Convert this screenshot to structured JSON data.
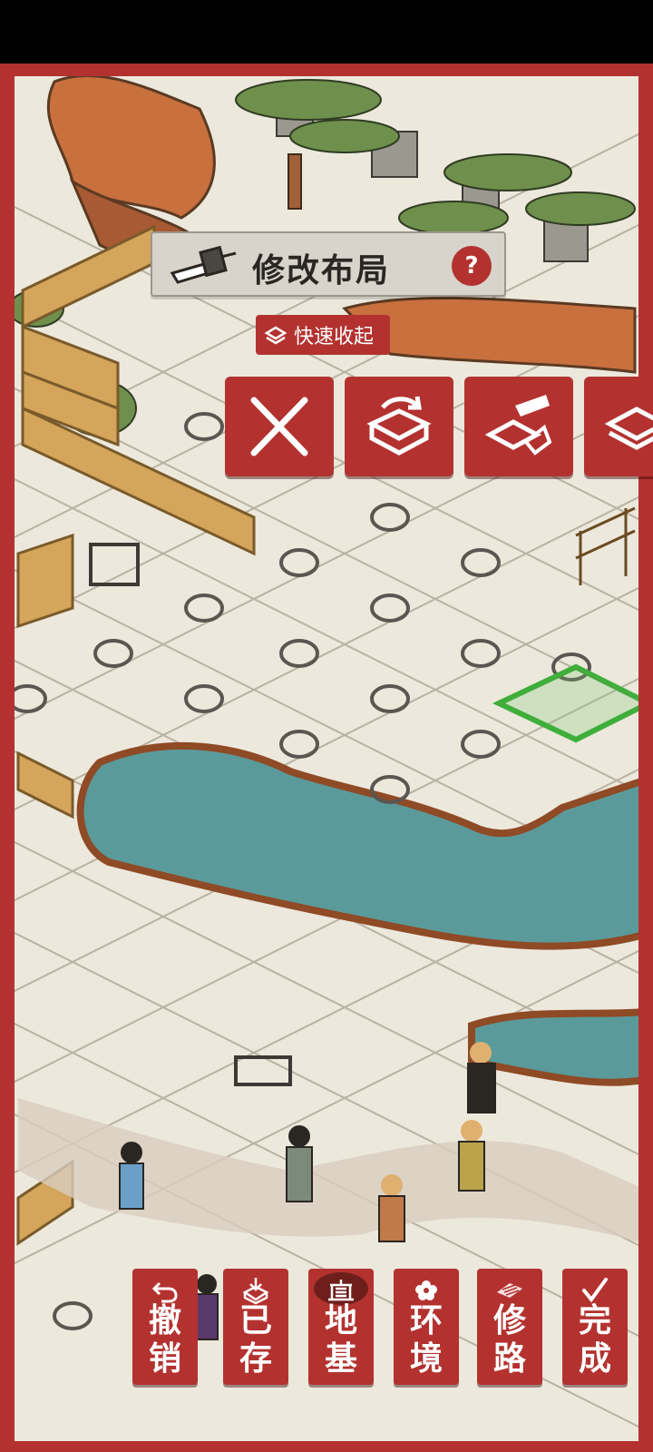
{
  "header": {
    "title": "修改布局",
    "help_label": "?",
    "quick_collect_label": "快速收起"
  },
  "tools": [
    {
      "name": "cancel",
      "icon": "close-icon"
    },
    {
      "name": "rotate",
      "icon": "rotate-icon"
    },
    {
      "name": "demolish",
      "icon": "demolish-icon"
    },
    {
      "name": "store",
      "icon": "store-icon"
    }
  ],
  "bottom_bar": {
    "undo": {
      "label": "撤销",
      "chars": [
        "撤",
        "销"
      ],
      "icon": "undo-icon"
    },
    "saved": {
      "label": "已存",
      "chars": [
        "已",
        "存"
      ],
      "icon": "stored-box-icon"
    },
    "foundation": {
      "label": "地基",
      "chars": [
        "地",
        "基"
      ],
      "icon": "foundation-icon",
      "active": true
    },
    "environment": {
      "label": "环境",
      "chars": [
        "环",
        "境"
      ],
      "icon": "flower-icon"
    },
    "road": {
      "label": "修路",
      "chars": [
        "修",
        "路"
      ],
      "icon": "road-icon"
    },
    "done": {
      "label": "完成",
      "chars": [
        "完",
        "成"
      ],
      "icon": "check-icon"
    }
  },
  "colors": {
    "frame_red": "#b3322f",
    "paper": "#ece8dc",
    "water": "#5b9a9a",
    "cliff": "#c9703f",
    "grass": "#6f8f4c",
    "selection_green": "#3fae3a"
  }
}
